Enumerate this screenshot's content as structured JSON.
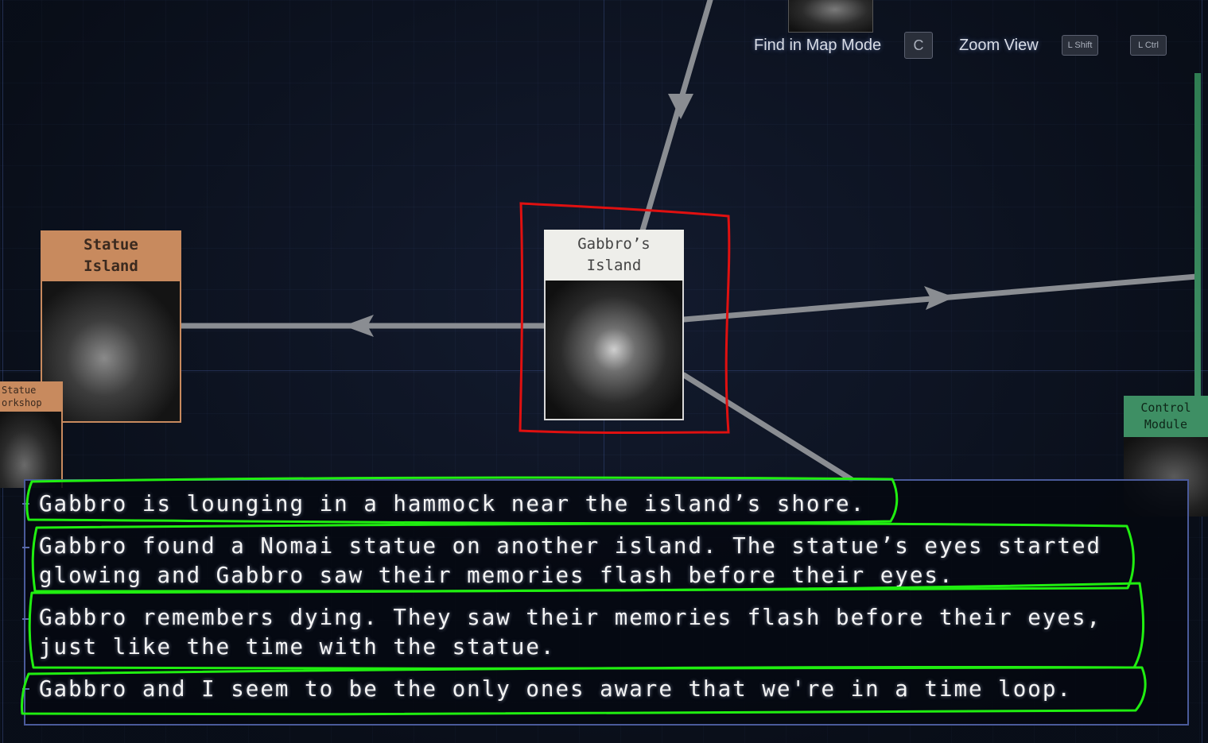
{
  "hud": {
    "find_label": "Find in Map Mode",
    "find_key": "C",
    "zoom_label": "Zoom View",
    "zoom_key_primary": "L Shift",
    "zoom_key_secondary": "L Ctrl"
  },
  "map": {
    "cards": {
      "statue_island": {
        "title": "Statue\nIsland",
        "category_color": "#c88a5e"
      },
      "statue_workshop": {
        "title": "Statue\norkshop",
        "category_color": "#c88a5e"
      },
      "gabbros_island": {
        "title": "Gabbro’s\nIsland",
        "selected": true
      },
      "control_module": {
        "title": "Control\nModule",
        "category_color": "#3e8f64"
      }
    }
  },
  "ship_log": {
    "entries": [
      {
        "text": "Gabbro is lounging in a hammock near the island’s shore."
      },
      {
        "text": "Gabbro found a Nomai statue on another island. The statue’s eyes started\nglowing and Gabbro saw their memories flash before their eyes."
      },
      {
        "text": "Gabbro remembers dying. They saw their memories flash before their eyes,\njust like the time with the statue."
      },
      {
        "text": "Gabbro and I seem to be the only ones aware that we're in a time loop."
      }
    ]
  },
  "colors": {
    "background": "#0d1422",
    "annotation_red": "#e01010",
    "annotation_green": "#20ee10",
    "panel_border": "#4a5a9a"
  }
}
